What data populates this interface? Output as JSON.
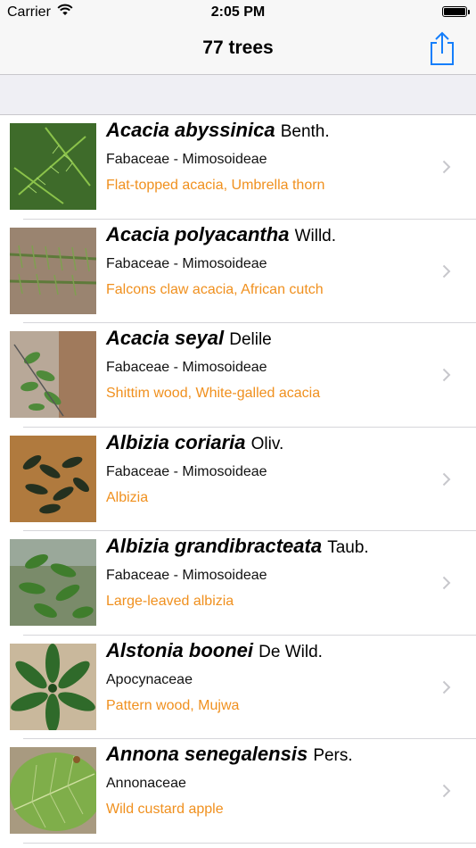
{
  "status": {
    "carrier": "Carrier",
    "time": "2:05 PM"
  },
  "nav": {
    "title": "77 trees"
  },
  "colors": {
    "accent": "#157efb",
    "common_name": "#f0901e"
  },
  "trees": [
    {
      "sci": "Acacia abyssinica",
      "author": "Benth.",
      "family": "Fabaceae - Mimosoideae",
      "common": "Flat-topped acacia, Umbrella thorn"
    },
    {
      "sci": "Acacia polyacantha",
      "author": "Willd.",
      "family": "Fabaceae - Mimosoideae",
      "common": "Falcons claw acacia, African cutch"
    },
    {
      "sci": "Acacia seyal",
      "author": "Delile",
      "family": "Fabaceae - Mimosoideae",
      "common": "Shittim wood, White-galled acacia"
    },
    {
      "sci": "Albizia coriaria",
      "author": "Oliv.",
      "family": "Fabaceae - Mimosoideae",
      "common": "Albizia"
    },
    {
      "sci": "Albizia grandibracteata",
      "author": "Taub.",
      "family": "Fabaceae - Mimosoideae",
      "common": "Large-leaved albizia"
    },
    {
      "sci": "Alstonia boonei",
      "author": "De Wild.",
      "family": "Apocynaceae",
      "common": "Pattern wood, Mujwa"
    },
    {
      "sci": "Annona senegalensis",
      "author": "Pers.",
      "family": "Annonaceae",
      "common": "Wild custard apple"
    }
  ]
}
